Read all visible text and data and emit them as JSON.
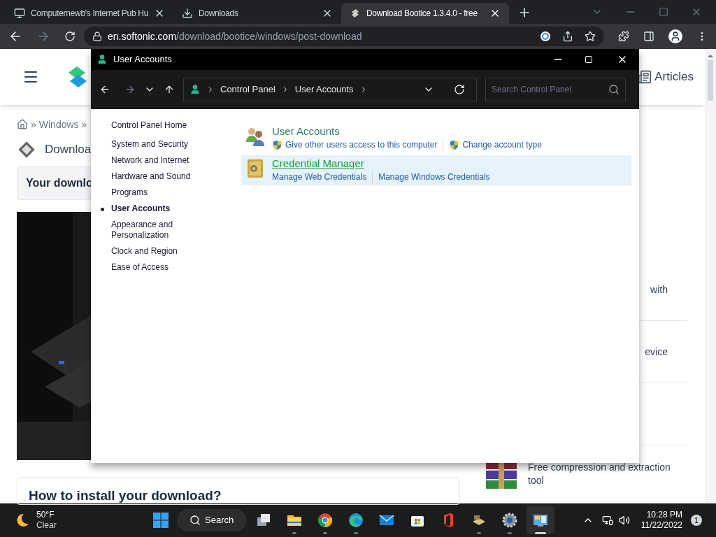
{
  "browser": {
    "tabs": [
      {
        "kind": "monitor",
        "title": "Computernewb's Internet Pub Hu",
        "selected": false
      },
      {
        "kind": "download",
        "title": "Downloads",
        "selected": false
      },
      {
        "kind": "softonic",
        "title": "Download Bootice 1.3.4.0 - free",
        "selected": true
      }
    ],
    "address": {
      "host": "en.softonic.com",
      "path": "/download/bootice/windows/post-download"
    }
  },
  "webpage": {
    "nav_link": "Articles",
    "breadcrumb": "Windows",
    "breadcrumb_separator": "»",
    "heading": "Downloa",
    "banner": "Your downlo",
    "snippets": [
      "with",
      "evice"
    ],
    "app": {
      "description": "Free compression and extraction tool"
    },
    "footer_heading": "How to install your download?"
  },
  "window": {
    "title": "User Accounts",
    "address": [
      "Control Panel",
      "User Accounts"
    ],
    "search": {
      "placeholder": "Search Control Panel"
    },
    "nav": [
      {
        "label": "Control Panel Home",
        "selected": false
      },
      {
        "label": "System and Security",
        "selected": false
      },
      {
        "label": "Network and Internet",
        "selected": false
      },
      {
        "label": "Hardware and Sound",
        "selected": false
      },
      {
        "label": "Programs",
        "selected": false
      },
      {
        "label": "User Accounts",
        "selected": true
      },
      {
        "label": "Appearance and Personalization",
        "selected": false
      },
      {
        "label": "Clock and Region",
        "selected": false
      },
      {
        "label": "Ease of Access",
        "selected": false
      }
    ],
    "categories": [
      {
        "kind": "users",
        "title": "User Accounts",
        "highlighted": false,
        "links": [
          {
            "label": "Give other users access to this computer",
            "shield": true
          },
          {
            "label": "Change account type",
            "shield": true
          }
        ]
      },
      {
        "kind": "vault",
        "title": "Credential Manager",
        "highlighted": true,
        "links": [
          {
            "label": "Manage Web Credentials",
            "shield": false
          },
          {
            "label": "Manage Windows Credentials",
            "shield": false
          }
        ]
      }
    ]
  },
  "taskbar": {
    "weather": {
      "temperature": "50°F",
      "condition": "Clear"
    },
    "search": "Search",
    "apps": [
      {
        "kind": "taskview",
        "running": false,
        "active": false
      },
      {
        "kind": "folder",
        "running": true,
        "active": false
      },
      {
        "kind": "chrome",
        "running": true,
        "active": false
      },
      {
        "kind": "edge",
        "running": true,
        "active": false
      },
      {
        "kind": "mail",
        "running": false,
        "active": false
      },
      {
        "kind": "store",
        "running": false,
        "active": false
      },
      {
        "kind": "office",
        "running": false,
        "active": false
      },
      {
        "kind": "drive",
        "running": true,
        "active": false
      },
      {
        "kind": "gear",
        "running": true,
        "active": false
      },
      {
        "kind": "controlpanel",
        "running": true,
        "active": true
      }
    ],
    "time": "10:28 PM",
    "date": "11/22/2022",
    "notifications": "1"
  }
}
